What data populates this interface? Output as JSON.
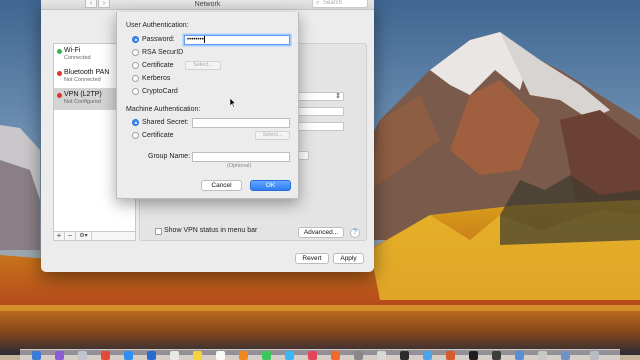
{
  "window": {
    "title": "Network",
    "search_placeholder": "Search",
    "nav_back": "‹",
    "nav_forward": "›"
  },
  "sidebar": {
    "services": [
      {
        "name": "Wi-Fi",
        "status": "Connected",
        "status_color": "#3ab54a"
      },
      {
        "name": "Bluetooth PAN",
        "status": "Not Connected",
        "status_color": "#e0332b"
      },
      {
        "name": "VPN (L2TP)",
        "status": "Not Configured",
        "status_color": "#e0332b"
      }
    ],
    "add": "+",
    "remove": "−",
    "gear": "⚙▾"
  },
  "detail": {
    "show_vpn_status": "Show VPN status in menu bar",
    "advanced": "Advanced...",
    "help": "?",
    "revert": "Revert",
    "apply": "Apply"
  },
  "auth_sheet": {
    "user_auth_heading": "User Authentication:",
    "user_options": [
      "Password:",
      "RSA SecurID",
      "Certificate",
      "Kerberos",
      "CryptoCard"
    ],
    "password_value": "••••••••",
    "select_label": "Select...",
    "machine_auth_heading": "Machine Authentication:",
    "machine_options": [
      "Shared Secret:",
      "Certificate"
    ],
    "group_name_label": "Group Name:",
    "optional_hint": "(Optional)",
    "cancel": "Cancel",
    "ok": "OK"
  },
  "colors": {
    "accent": "#3f8cf5",
    "primary_button": "#2f7df6"
  }
}
